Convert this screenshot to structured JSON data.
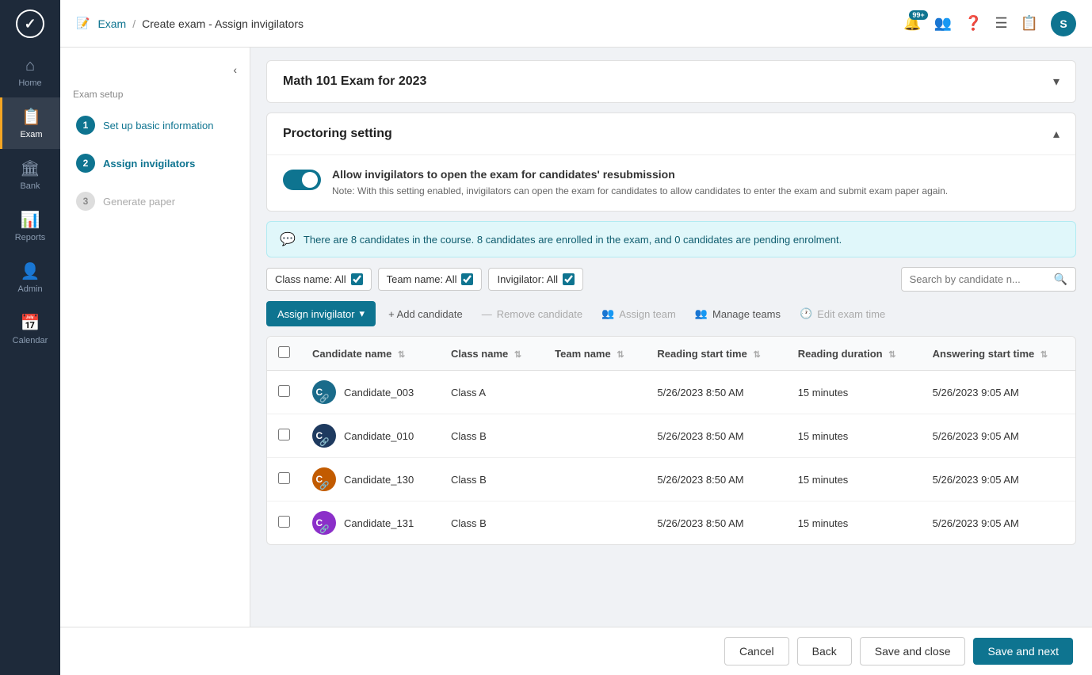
{
  "app": {
    "logo_text": "✓",
    "badge_count": "99+"
  },
  "sidebar": {
    "items": [
      {
        "id": "home",
        "label": "Home",
        "icon": "⌂",
        "active": false
      },
      {
        "id": "exam",
        "label": "Exam",
        "icon": "📋",
        "active": true
      },
      {
        "id": "bank",
        "label": "Bank",
        "icon": "🏦",
        "active": false
      },
      {
        "id": "reports",
        "label": "Reports",
        "icon": "📊",
        "active": false
      },
      {
        "id": "admin",
        "label": "Admin",
        "icon": "👤",
        "active": false
      },
      {
        "id": "calendar",
        "label": "Calendar",
        "icon": "📅",
        "active": false
      }
    ]
  },
  "topbar": {
    "breadcrumb_link": "Exam",
    "breadcrumb_separator": "/",
    "breadcrumb_current": "Create exam - Assign invigilators",
    "breadcrumb_icon": "📝",
    "user_initial": "S"
  },
  "left_panel": {
    "collapse_icon": "‹",
    "exam_setup_label": "Exam setup",
    "steps": [
      {
        "num": "1",
        "label": "Set up basic information",
        "state": "completed"
      },
      {
        "num": "2",
        "label": "Assign invigilators",
        "state": "active"
      },
      {
        "num": "3",
        "label": "Generate paper",
        "state": "inactive"
      }
    ]
  },
  "exam_card": {
    "title": "Math 101 Exam for 2023",
    "collapsed": true
  },
  "proctoring_card": {
    "title": "Proctoring setting",
    "toggle_checked": true,
    "toggle_label": "Allow invigilators to open the exam for candidates' resubmission",
    "toggle_note": "Note: With this setting enabled, invigilators can open the exam for candidates to allow candidates to enter the exam and submit exam paper again."
  },
  "info_banner": {
    "text": "There are 8 candidates in the course. 8 candidates are enrolled in the exam, and 0 candidates are pending enrolment."
  },
  "filters": {
    "class_filter": "Class name: All",
    "team_filter": "Team name: All",
    "invigilator_filter": "Invigilator: All",
    "search_placeholder": "Search by candidate n..."
  },
  "actions": {
    "assign_invigilator": "Assign invigilator",
    "add_candidate": "+ Add candidate",
    "remove_candidate": "Remove candidate",
    "assign_team": "Assign team",
    "manage_teams": "Manage teams",
    "edit_exam_time": "Edit exam time"
  },
  "table": {
    "headers": [
      {
        "id": "candidate_name",
        "label": "Candidate name"
      },
      {
        "id": "class_name",
        "label": "Class name"
      },
      {
        "id": "team_name",
        "label": "Team name"
      },
      {
        "id": "reading_start_time",
        "label": "Reading start time"
      },
      {
        "id": "reading_duration",
        "label": "Reading duration"
      },
      {
        "id": "answering_start_time",
        "label": "Answering start time"
      }
    ],
    "rows": [
      {
        "id": "candidate_003",
        "avatar_color": "#1a6b8a",
        "avatar_initials": "C",
        "candidate_name": "Candidate_003",
        "class_name": "Class A",
        "team_name": "",
        "reading_start_time": "5/26/2023 8:50 AM",
        "reading_duration": "15 minutes",
        "answering_start_time": "5/26/2023 9:05 AM"
      },
      {
        "id": "candidate_010",
        "avatar_color": "#1e3a5f",
        "avatar_initials": "C",
        "candidate_name": "Candidate_010",
        "class_name": "Class B",
        "team_name": "",
        "reading_start_time": "5/26/2023 8:50 AM",
        "reading_duration": "15 minutes",
        "answering_start_time": "5/26/2023 9:05 AM"
      },
      {
        "id": "candidate_130",
        "avatar_color": "#c25b00",
        "avatar_initials": "C",
        "candidate_name": "Candidate_130",
        "class_name": "Class B",
        "team_name": "",
        "reading_start_time": "5/26/2023 8:50 AM",
        "reading_duration": "15 minutes",
        "answering_start_time": "5/26/2023 9:05 AM"
      },
      {
        "id": "candidate_131",
        "avatar_color": "#8b2fc9",
        "avatar_initials": "C",
        "candidate_name": "Candidate_131",
        "class_name": "Class B",
        "team_name": "",
        "reading_start_time": "5/26/2023 8:50 AM",
        "reading_duration": "15 minutes",
        "answering_start_time": "5/26/2023 9:05 AM"
      }
    ]
  },
  "bottom_buttons": {
    "cancel": "Cancel",
    "back": "Back",
    "save_close": "Save and close",
    "save_next": "Save and next"
  }
}
